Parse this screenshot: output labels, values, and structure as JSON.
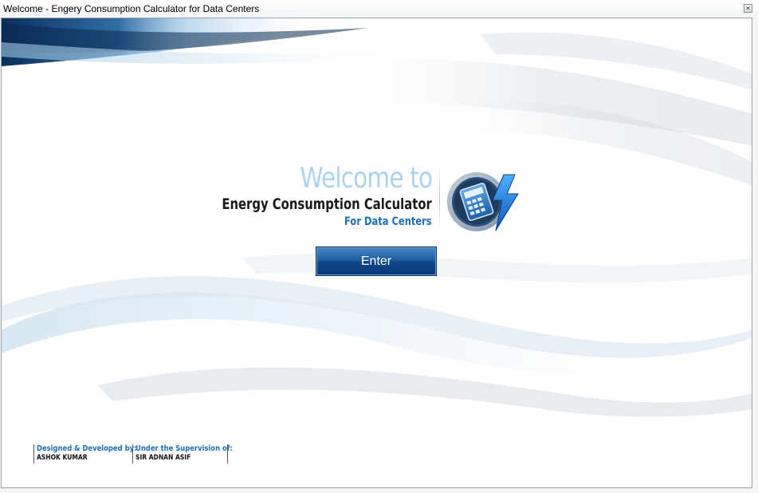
{
  "window": {
    "title": "Welcome - Engery Consumption Calculator for Data Centers",
    "close_icon": "close-icon"
  },
  "logo": {
    "welcome": "Welcome to",
    "app_name": "Energy Consumption Calculator",
    "app_sub": "For Data Centers",
    "icon": "calculator-lightning-icon"
  },
  "enter_button": {
    "label": "Enter"
  },
  "credits": {
    "developer_role": "Designed & Developed by:",
    "developer_name": "ASHOK KUMAR",
    "supervisor_role": "Under the Supervision of:",
    "supervisor_name": "SIR ADNAN ASIF"
  },
  "colors": {
    "accent_blue": "#1c6fb5",
    "welcome_light_blue": "#a9d3ef",
    "button_blue": "#1b5ea3"
  }
}
